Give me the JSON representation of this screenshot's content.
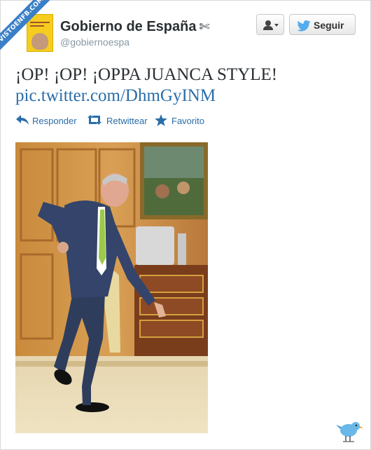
{
  "ribbon": {
    "text": "VISTOENFB.COM"
  },
  "header": {
    "name": "Gobierno de España",
    "name_symbol": "✄",
    "handle": "@gobiernoespa"
  },
  "buttons": {
    "user_menu": "user-dropdown-icon",
    "follow_label": "Seguir"
  },
  "tweet": {
    "text": "¡OP! ¡OP! ¡OPPA JUANCA STYLE!",
    "link": "pic.twitter.com/DhmGyINM"
  },
  "actions": [
    {
      "label": "Responder",
      "icon": "reply-icon"
    },
    {
      "label": "Retwittear",
      "icon": "retweet-icon"
    },
    {
      "label": "Favorito",
      "icon": "star-icon"
    }
  ],
  "colors": {
    "link": "#2a6da8",
    "ribbon": "#3a7fc8",
    "twitter_blue": "#55acee"
  }
}
